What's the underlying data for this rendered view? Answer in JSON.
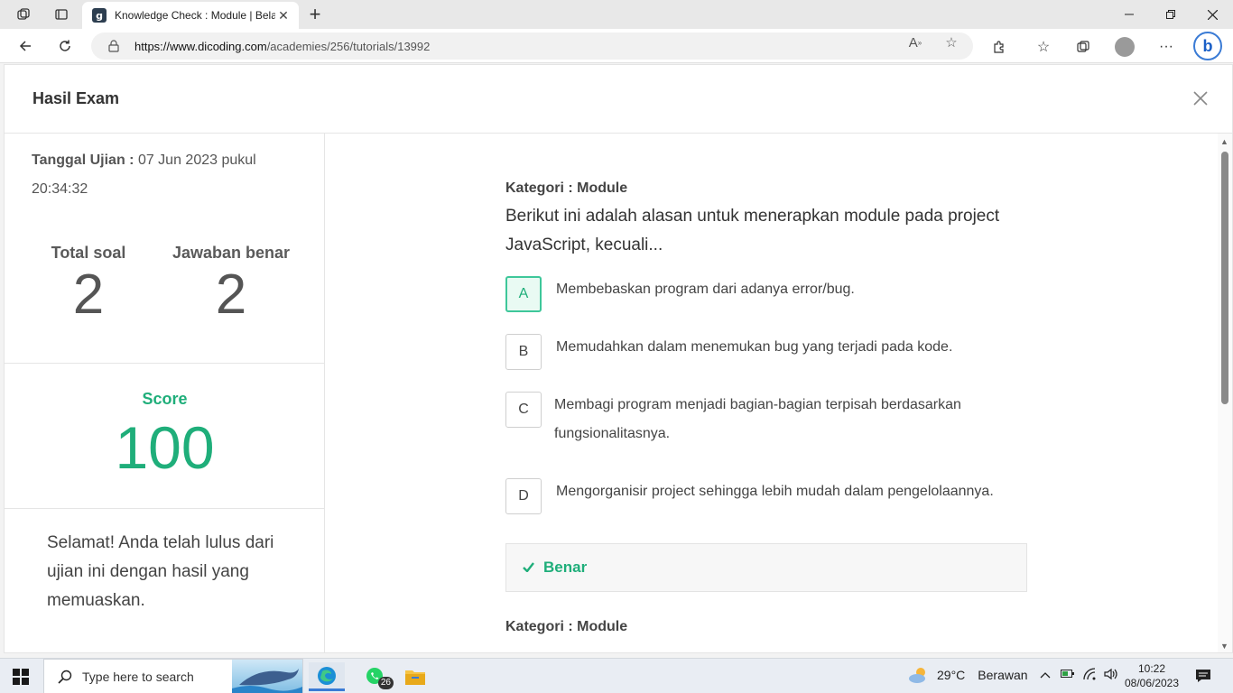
{
  "browser": {
    "tab_title": "Knowledge Check : Module | Bela",
    "tab_favicon": "g",
    "url_host": "https://www.dicoding.com",
    "url_path": "/academies/256/tutorials/13992"
  },
  "modal": {
    "title": "Hasil Exam"
  },
  "summary": {
    "date_label": "Tanggal Ujian :",
    "date_value": "07 Jun 2023 pukul 20:34:32",
    "total_label": "Total soal",
    "total_value": "2",
    "correct_label": "Jawaban benar",
    "correct_value": "2",
    "score_label": "Score",
    "score_value": "100",
    "message": "Selamat! Anda telah lulus dari ujian ini dengan hasil yang memuaskan."
  },
  "questions": [
    {
      "category": "Kategori : Module",
      "text": "Berikut ini adalah alasan untuk menerapkan module pada project JavaScript, kecuali...",
      "options": [
        {
          "letter": "A",
          "text": "Membebaskan program dari adanya error/bug.",
          "selected": true
        },
        {
          "letter": "B",
          "text": "Memudahkan dalam menemukan bug yang terjadi pada kode.",
          "selected": false
        },
        {
          "letter": "C",
          "text": "Membagi program menjadi bagian-bagian terpisah berdasarkan fungsionalitasnya.",
          "selected": false
        },
        {
          "letter": "D",
          "text": "Mengorganisir project sehingga lebih mudah dalam pengelolaannya.",
          "selected": false
        }
      ],
      "result": "Benar"
    },
    {
      "category": "Kategori : Module"
    }
  ],
  "taskbar": {
    "search_placeholder": "Type here to search",
    "whatsapp_badge": "26",
    "weather_temp": "29°C",
    "weather_desc": "Berawan",
    "time": "10:22",
    "date": "08/06/2023"
  },
  "colors": {
    "accent_green": "#1fae7a",
    "edge_blue": "#3a7bd5"
  }
}
